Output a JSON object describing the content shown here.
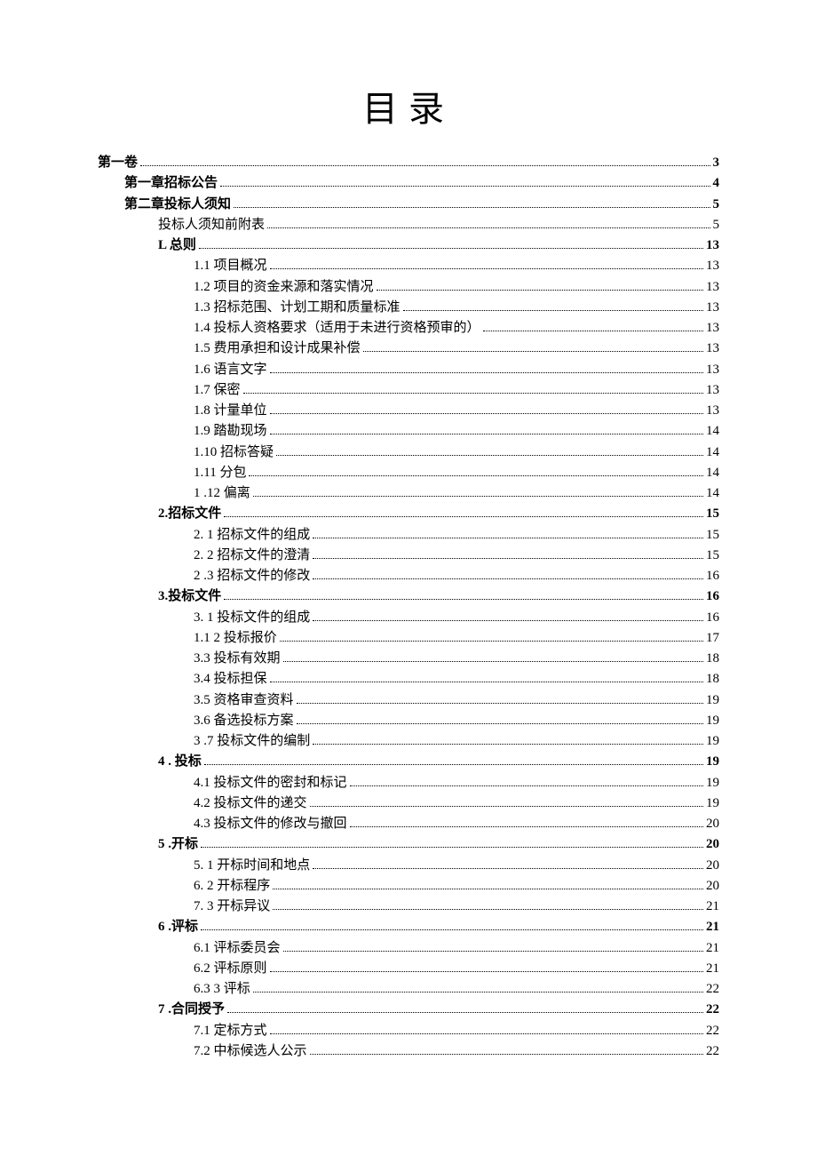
{
  "title": "目录",
  "toc": [
    {
      "text": "第一卷 ",
      "page": "3",
      "level": 0,
      "bold": true
    },
    {
      "text": "第一章招标公告",
      "page": "4",
      "level": 1,
      "bold": true
    },
    {
      "text": "第二章投标人须知",
      "page": "5",
      "level": 1,
      "bold": true
    },
    {
      "text": "投标人须知前附表 ",
      "page": "5",
      "level": 2,
      "bold": false
    },
    {
      "text": "L 总则",
      "page": "13",
      "level": 2,
      "bold": true
    },
    {
      "text": "1.1   项目概况",
      "page": "13",
      "level": 3,
      "bold": false
    },
    {
      "text": "1.2   项目的资金来源和落实情况",
      "page": "13",
      "level": 3,
      "bold": false
    },
    {
      "text": "1.3   招标范围、计划工期和质量标准",
      "page": "13",
      "level": 3,
      "bold": false
    },
    {
      "text": "1.4   投标人资格要求（适用于未进行资格预审的）",
      "page": "13",
      "level": 3,
      "bold": false
    },
    {
      "text": "1.5   费用承担和设计成果补偿",
      "page": "13",
      "level": 3,
      "bold": false
    },
    {
      "text": "1.6   语言文字",
      "page": "13",
      "level": 3,
      "bold": false
    },
    {
      "text": "1.7   保密",
      "page": "13",
      "level": 3,
      "bold": false
    },
    {
      "text": "1.8   计量单位",
      "page": "13",
      "level": 3,
      "bold": false
    },
    {
      "text": "1.9   踏勘现场",
      "page": "14",
      "level": 3,
      "bold": false
    },
    {
      "text": "1.10 招标答疑 ",
      "page": "14",
      "level": 3,
      "bold": false
    },
    {
      "text": "1.11 分包 ",
      "page": "14",
      "level": 3,
      "bold": false
    },
    {
      "text": "1   .12 偏离 ",
      "page": "14",
      "level": 3,
      "bold": false
    },
    {
      "text": "2.招标文件 ",
      "page": "15",
      "level": 2,
      "bold": true
    },
    {
      "text": "2.   1 招标文件的组成",
      "page": "15",
      "level": 3,
      "bold": false
    },
    {
      "text": "2.   2 招标文件的澄清",
      "page": "15",
      "level": 3,
      "bold": false
    },
    {
      "text": "2   .3 招标文件的修改 ",
      "page": "16",
      "level": 3,
      "bold": false
    },
    {
      "text": "3.投标文件 ",
      "page": "16",
      "level": 2,
      "bold": true
    },
    {
      "text": "3.   1 投标文件的组成",
      "page": "16",
      "level": 3,
      "bold": false
    },
    {
      "text": "1.1 2 投标报价",
      "page": "17",
      "level": 3,
      "bold": false
    },
    {
      "text": "3.3   投标有效期",
      "page": "18",
      "level": 3,
      "bold": false
    },
    {
      "text": "3.4   投标担保",
      "page": "18",
      "level": 3,
      "bold": false
    },
    {
      "text": "3.5   资格审查资料",
      "page": "19",
      "level": 3,
      "bold": false
    },
    {
      "text": "3.6   备选投标方案",
      "page": "19",
      "level": 3,
      "bold": false
    },
    {
      "text": "3   .7 投标文件的编制 ",
      "page": "19",
      "level": 3,
      "bold": false
    },
    {
      "text": "4   . 投标",
      "page": "19",
      "level": 2,
      "bold": true
    },
    {
      "text": "4.1   投标文件的密封和标记",
      "page": "19",
      "level": 3,
      "bold": false
    },
    {
      "text": "4.2   投标文件的递交",
      "page": "19",
      "level": 3,
      "bold": false
    },
    {
      "text": "4.3   投标文件的修改与撤回",
      "page": "20",
      "level": 3,
      "bold": false
    },
    {
      "text": "5   .开标 ",
      "page": "20",
      "level": 2,
      "bold": true
    },
    {
      "text": "5.   1 开标时间和地点",
      "page": "20",
      "level": 3,
      "bold": false
    },
    {
      "text": "6.   2 开标程序",
      "page": "20",
      "level": 3,
      "bold": false
    },
    {
      "text": "7.   3 开标异议",
      "page": "21",
      "level": 3,
      "bold": false
    },
    {
      "text": "6   .评标 ",
      "page": "21",
      "level": 2,
      "bold": true
    },
    {
      "text": "6.1   评标委员会",
      "page": "21",
      "level": 3,
      "bold": false
    },
    {
      "text": "6.2   评标原则",
      "page": "21",
      "level": 3,
      "bold": false
    },
    {
      "text": "6.3 3 评标 ",
      "page": "22",
      "level": 3,
      "bold": false
    },
    {
      "text": "7   .合同授予 ",
      "page": "22",
      "level": 2,
      "bold": true
    },
    {
      "text": "7.1 定标方式",
      "page": "22",
      "level": 3,
      "bold": false
    },
    {
      "text": "7.2 中标候选人公示 ",
      "page": "22",
      "level": 3,
      "bold": false
    }
  ]
}
